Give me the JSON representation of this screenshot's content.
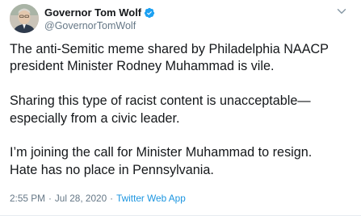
{
  "author": {
    "display_name": "Governor Tom Wolf",
    "handle": "@GovernorTomWolf",
    "verified_icon": "verified-badge-icon",
    "verified_color": "#1da1f2"
  },
  "more_icon": "chevron-down-icon",
  "tweet": {
    "paragraphs": [
      [
        "The anti-Semitic meme shared by Philadelphia NAACP",
        "president Minister Rodney Muhammad is vile."
      ],
      [
        "Sharing this type of racist content is unacceptable—",
        "especially from a civic leader."
      ],
      [
        "I’m joining the call for Minister Muhammad to resign.",
        "Hate has no place in Pennsylvania."
      ]
    ]
  },
  "meta": {
    "time": "2:55 PM",
    "separator": "·",
    "date": "Jul 28, 2020",
    "source": "Twitter Web App"
  },
  "colors": {
    "text": "#14171a",
    "secondary": "#657786",
    "link": "#1b95e0"
  }
}
